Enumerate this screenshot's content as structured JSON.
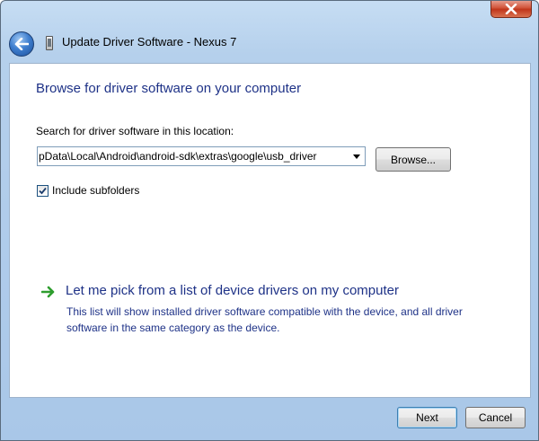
{
  "window": {
    "title": "Update Driver Software - Nexus 7"
  },
  "content": {
    "heading": "Browse for driver software on your computer",
    "search_label": "Search for driver software in this location:",
    "search_path": "pData\\Local\\Android\\android-sdk\\extras\\google\\usb_driver",
    "browse_label": "Browse...",
    "include_subfolders_label": "Include subfolders",
    "include_subfolders_checked": true,
    "pick_link": "Let me pick from a list of device drivers on my computer",
    "pick_description": "This list will show installed driver software compatible with the device, and all driver software in the same category as the device."
  },
  "footer": {
    "next_label": "Next",
    "cancel_label": "Cancel"
  },
  "icons": {
    "close": "close-icon",
    "back": "back-arrow-icon",
    "device": "device-icon",
    "pick": "green-arrow-icon",
    "dropdown": "chevron-down-icon",
    "checkmark": "checkmark-icon"
  },
  "colors": {
    "heading": "#1e3287",
    "close_button": "#c0361b",
    "pick_arrow": "#2e9d2e"
  }
}
